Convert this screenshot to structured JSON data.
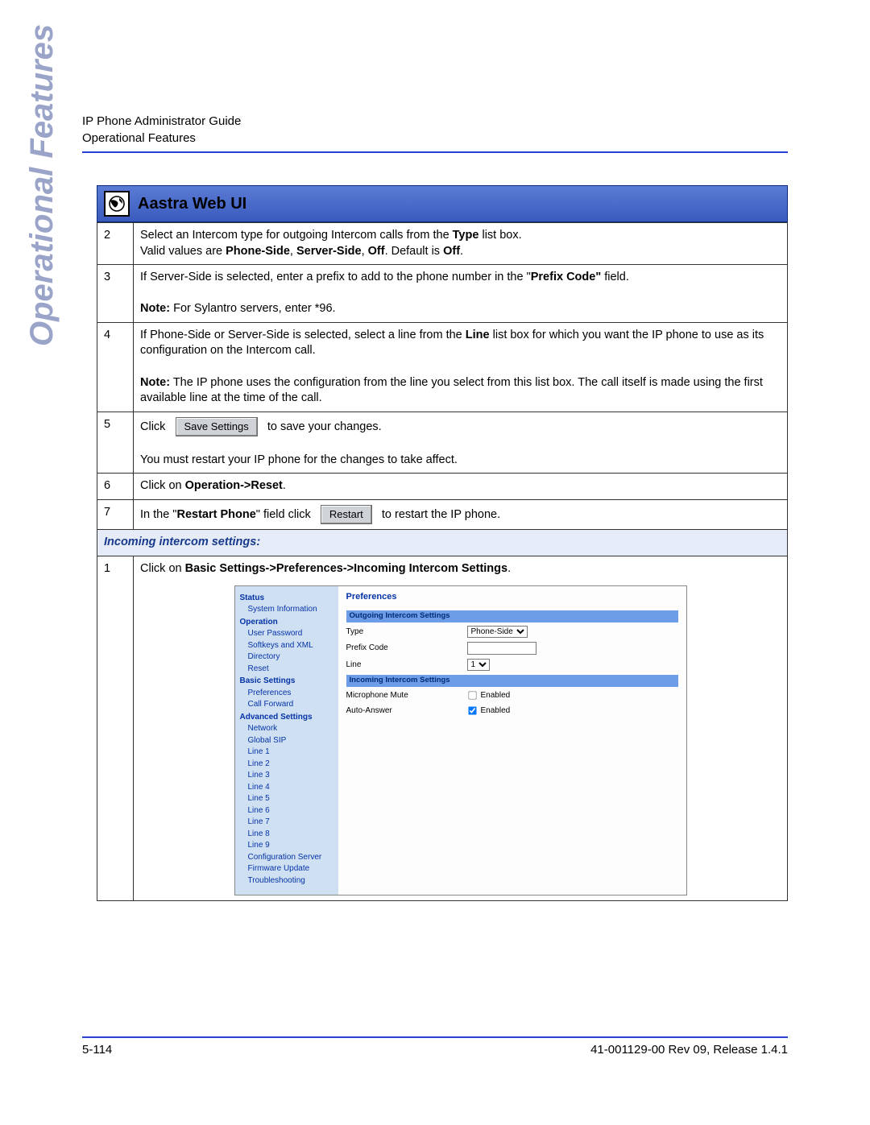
{
  "header": {
    "line1": "IP Phone Administrator Guide",
    "line2": "Operational Features"
  },
  "side_label": "Operational Features",
  "web_ui_title": "Aastra Web UI",
  "steps_top": [
    {
      "num": "2",
      "t1": "Select an Intercom type for outgoing Intercom calls from the ",
      "b1": "Type",
      "t2": " list box.",
      "t3": "Valid values are ",
      "b2": "Phone-Side",
      "t4": ", ",
      "b3": "Server-Side",
      "t5": ", ",
      "b4": "Off",
      "t6": ". Default is ",
      "b5": "Off",
      "t7": "."
    },
    {
      "num": "3",
      "t1": "If Server-Side is selected, enter a prefix to add to the phone number in the \"",
      "b1": "Prefix Code\"",
      "t2": " field.",
      "note_label": "Note:",
      "note_text": " For Sylantro servers, enter *96."
    },
    {
      "num": "4",
      "t1": "If Phone-Side or Server-Side is selected, select a line from the ",
      "b1": "Line",
      "t2": " list box for which you want the IP phone to use as its configuration on the Intercom call.",
      "note_label": "Note:",
      "note_text": " The IP phone uses the configuration from the line you select from this list box. The call itself is made using the first available line at the time of the call."
    },
    {
      "num": "5",
      "pre": "Click",
      "button": "Save Settings",
      "post": "to save your changes.",
      "extra": "You must restart your IP phone for the changes to take affect."
    },
    {
      "num": "6",
      "t1": "Click on ",
      "b1": "Operation->Reset",
      "t2": "."
    },
    {
      "num": "7",
      "t1": "In the \"",
      "b1": "Restart Phone",
      "t2": "\" field click",
      "button": "Restart",
      "post": "to restart the IP phone."
    }
  ],
  "section_title": "Incoming intercom settings:",
  "steps_bottom": [
    {
      "num": "1",
      "t1": "Click on ",
      "b1": "Basic Settings->Preferences->Incoming Intercom Settings",
      "t2": "."
    }
  ],
  "embedded": {
    "nav": {
      "status": "Status",
      "status_items": [
        "System Information"
      ],
      "operation": "Operation",
      "operation_items": [
        "User Password",
        "Softkeys and XML",
        "Directory",
        "Reset"
      ],
      "basic": "Basic Settings",
      "basic_items": [
        "Preferences",
        "Call Forward"
      ],
      "advanced": "Advanced Settings",
      "advanced_items": [
        "Network",
        "Global SIP",
        "Line 1",
        "Line 2",
        "Line 3",
        "Line 4",
        "Line 5",
        "Line 6",
        "Line 7",
        "Line 8",
        "Line 9",
        "Configuration Server",
        "Firmware Update",
        "Troubleshooting"
      ]
    },
    "main": {
      "title": "Preferences",
      "band1": "Outgoing Intercom Settings",
      "type_label": "Type",
      "type_value": "Phone-Side",
      "prefix_label": "Prefix Code",
      "line_label": "Line",
      "line_value": "1",
      "band2": "Incoming Intercom Settings",
      "mic_label": "Microphone Mute",
      "mic_enabled": false,
      "auto_label": "Auto-Answer",
      "auto_enabled": true,
      "enabled_text": "Enabled"
    }
  },
  "footer": {
    "left": "5-114",
    "right": "41-001129-00 Rev 09, Release 1.4.1"
  }
}
